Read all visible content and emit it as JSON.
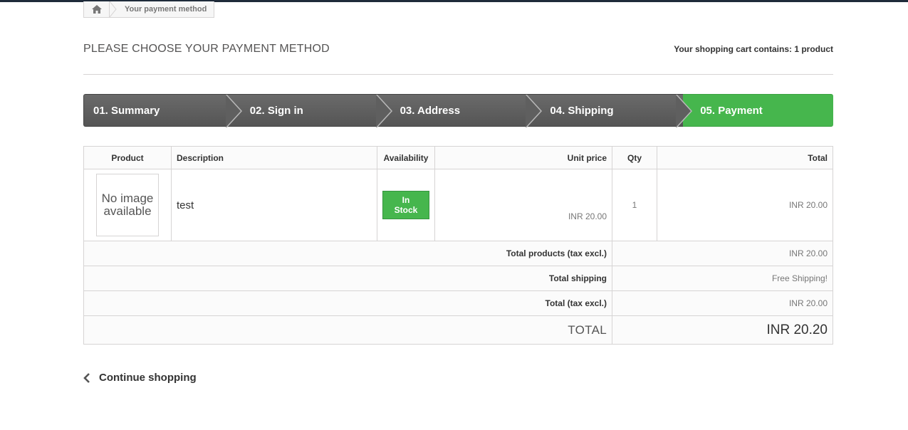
{
  "breadcrumb": {
    "home_icon": "home-icon",
    "current": "Your payment method"
  },
  "heading": {
    "title": "PLEASE CHOOSE YOUR PAYMENT METHOD",
    "cart_summary": "Your shopping cart contains: 1 product"
  },
  "steps": [
    {
      "label": "01. Summary",
      "state": "done"
    },
    {
      "label": "02. Sign in",
      "state": "done"
    },
    {
      "label": "03. Address",
      "state": "done"
    },
    {
      "label": "04. Shipping",
      "state": "done"
    },
    {
      "label": "05. Payment",
      "state": "current"
    }
  ],
  "table": {
    "headers": {
      "product": "Product",
      "description": "Description",
      "availability": "Availability",
      "unit_price": "Unit price",
      "qty": "Qty",
      "total": "Total"
    },
    "item": {
      "image_placeholder": "No image available",
      "description": "test",
      "availability": "In Stock",
      "unit_price": "INR 20.00",
      "qty": "1",
      "total": "INR 20.00"
    },
    "summary": {
      "products_label": "Total products (tax excl.)",
      "products_value": "INR 20.00",
      "shipping_label": "Total shipping",
      "shipping_value": "Free Shipping!",
      "taxexcl_label": "Total (tax excl.)",
      "taxexcl_value": "INR 20.00",
      "grand_label": "TOTAL",
      "grand_value": "INR 20.20"
    }
  },
  "continue_label": "Continue shopping",
  "colors": {
    "accent_green": "#46b64d",
    "step_gray": "#5f5f5f",
    "top_bar": "#1f2b3a"
  }
}
